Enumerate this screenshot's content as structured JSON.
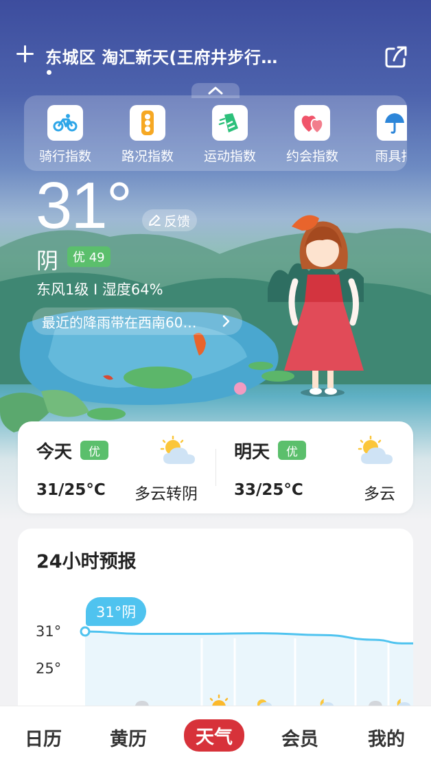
{
  "header": {
    "location": "东城区 淘汇新天(王府井步行…"
  },
  "indices": [
    {
      "label": "骑行指数",
      "icon": "bicycle-icon"
    },
    {
      "label": "路况指数",
      "icon": "traffic-light-icon"
    },
    {
      "label": "运动指数",
      "icon": "running-shoe-icon"
    },
    {
      "label": "约会指数",
      "icon": "hearts-icon"
    },
    {
      "label": "雨具指",
      "icon": "umbrella-icon"
    }
  ],
  "current": {
    "temperature": "31°",
    "feedback_label": "反馈",
    "condition": "阴",
    "aqi": "优 49",
    "wind_humidity": "东风1级 I 湿度64%",
    "rain_notice": "最近的降雨带在西南60…"
  },
  "days": {
    "today": {
      "name": "今天",
      "badge": "优",
      "range": "31/25°C",
      "desc": "多云转阴"
    },
    "tomorrow": {
      "name": "明天",
      "badge": "优",
      "range": "33/25°C",
      "desc": "多云"
    }
  },
  "forecast": {
    "title": "24小时预报",
    "current_tag": "31°阴",
    "y_labels": [
      "31°",
      "25°"
    ]
  },
  "chart_data": {
    "type": "area",
    "x": [
      0,
      1,
      2,
      3,
      4,
      5,
      6,
      7
    ],
    "values": [
      31,
      30.6,
      30.6,
      30.7,
      30.4,
      29.6,
      29.0,
      29.0
    ],
    "ylim": [
      25,
      31
    ],
    "icons": [
      "cloudy-icon",
      "sunny-icon",
      "partly-cloudy-icon",
      "partly-cloudy-night-icon",
      "cloudy-icon",
      "partly-cloudy-night-icon"
    ],
    "line_color": "#4fc3ef"
  },
  "nav": {
    "items": [
      "日历",
      "黄历",
      "天气",
      "会员",
      "我的"
    ],
    "active": "天气"
  },
  "colors": {
    "accent_red": "#d7323a",
    "aqi_green": "#5bbf6c",
    "chart_blue": "#4fc3ef"
  }
}
